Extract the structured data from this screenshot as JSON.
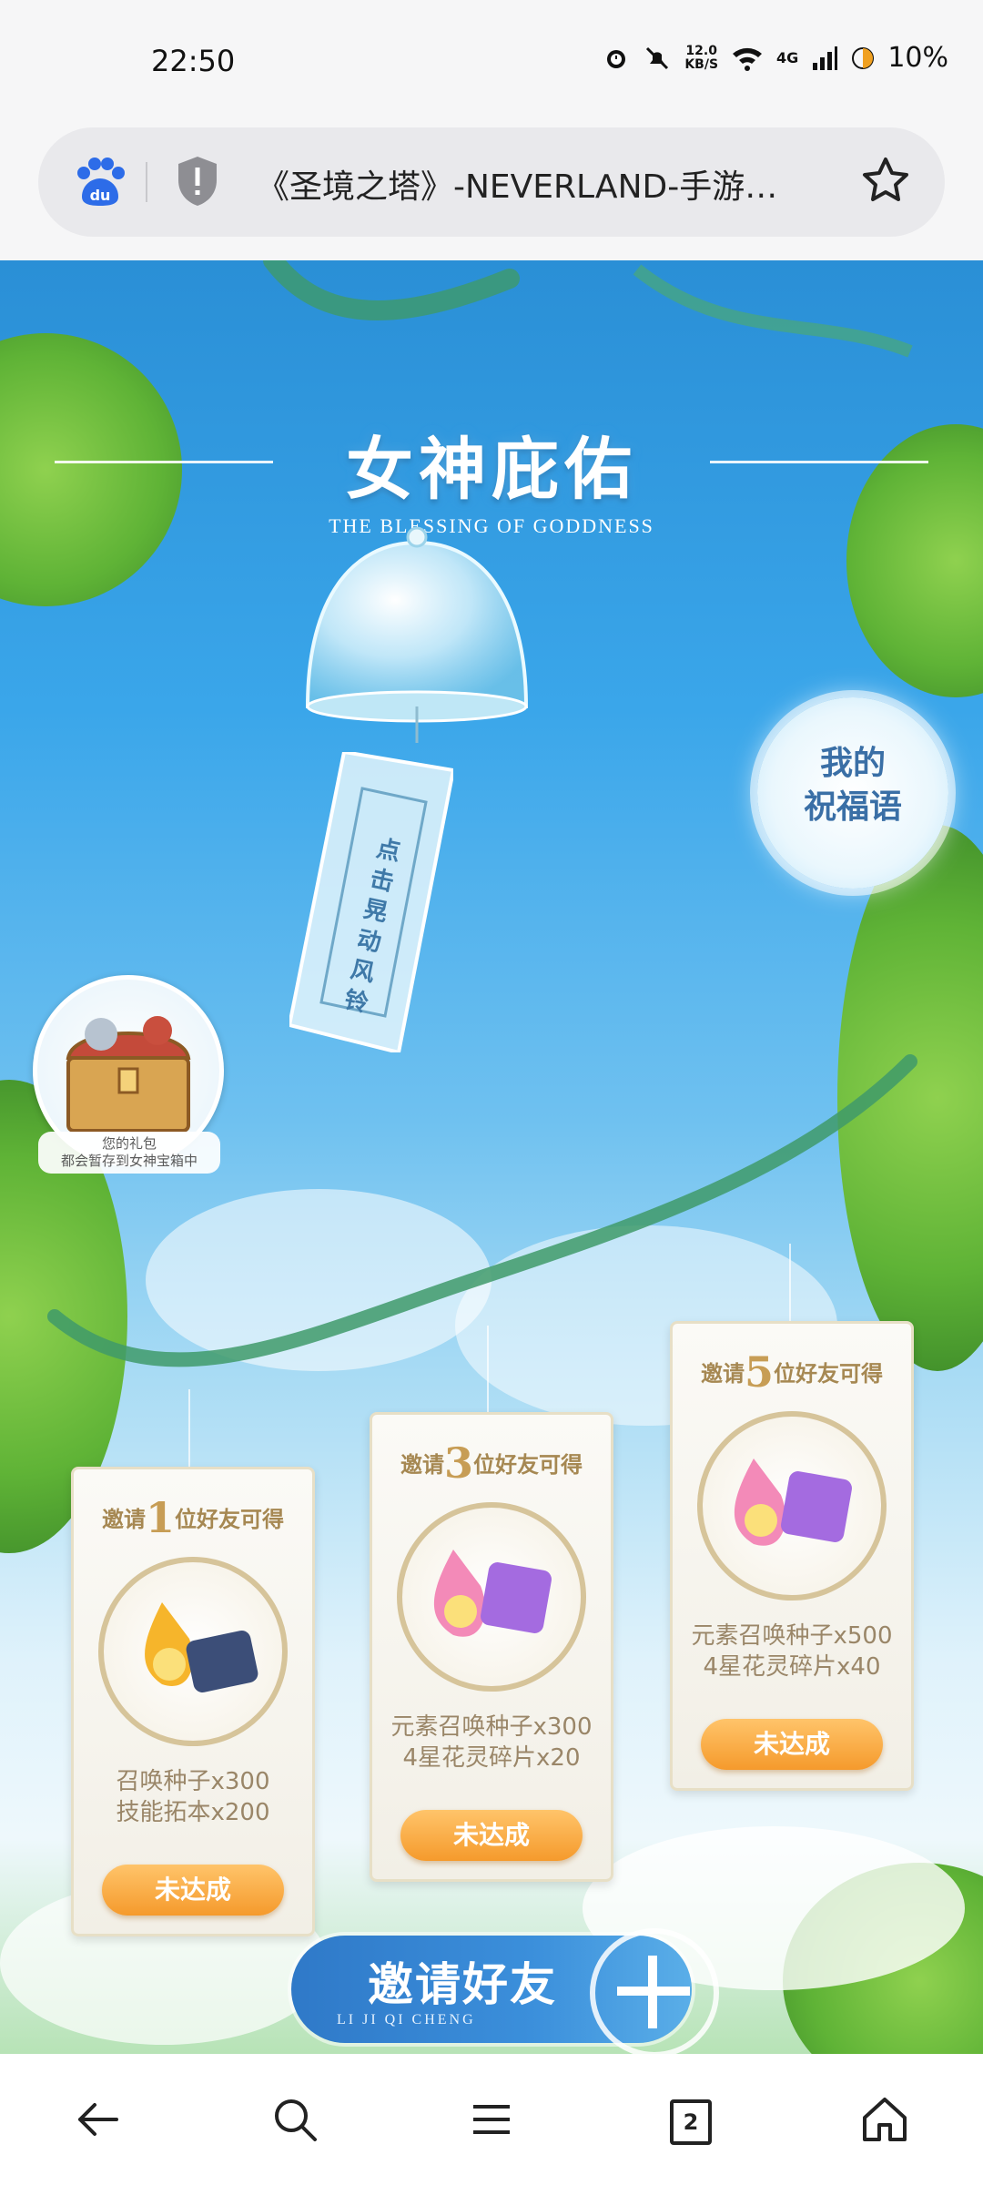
{
  "status": {
    "time": "22:50",
    "speed": "12.0",
    "speed_unit": "KB/S",
    "network": "4G",
    "battery": "10%"
  },
  "browser": {
    "url_title": "《圣境之塔》-NEVERLAND-手游…"
  },
  "page": {
    "title": "女神庇佑",
    "subtitle": "THE BLESSING OF GODDNESS",
    "talisman_text": "点击晃动风铃",
    "blessing_line1": "我的",
    "blessing_line2": "祝福语",
    "chest_line1": "您的礼包",
    "chest_line2": "都会暂存到女神宝箱中"
  },
  "rewards": [
    {
      "count": "1",
      "head_pre": "邀请",
      "head_post": "位好友可得",
      "line1": "召唤种子x300",
      "line2": "技能拓本x200",
      "button": "未达成"
    },
    {
      "count": "3",
      "head_pre": "邀请",
      "head_post": "位好友可得",
      "line1": "元素召唤种子x300",
      "line2": "4星花灵碎片x20",
      "button": "未达成"
    },
    {
      "count": "5",
      "head_pre": "邀请",
      "head_post": "位好友可得",
      "line1": "元素召唤种子x500",
      "line2": "4星花灵碎片x40",
      "button": "未达成"
    }
  ],
  "invite": {
    "label": "邀请好友",
    "sublabel": "LI JI QI CHENG"
  },
  "nav": {
    "tabs_count": "2"
  }
}
